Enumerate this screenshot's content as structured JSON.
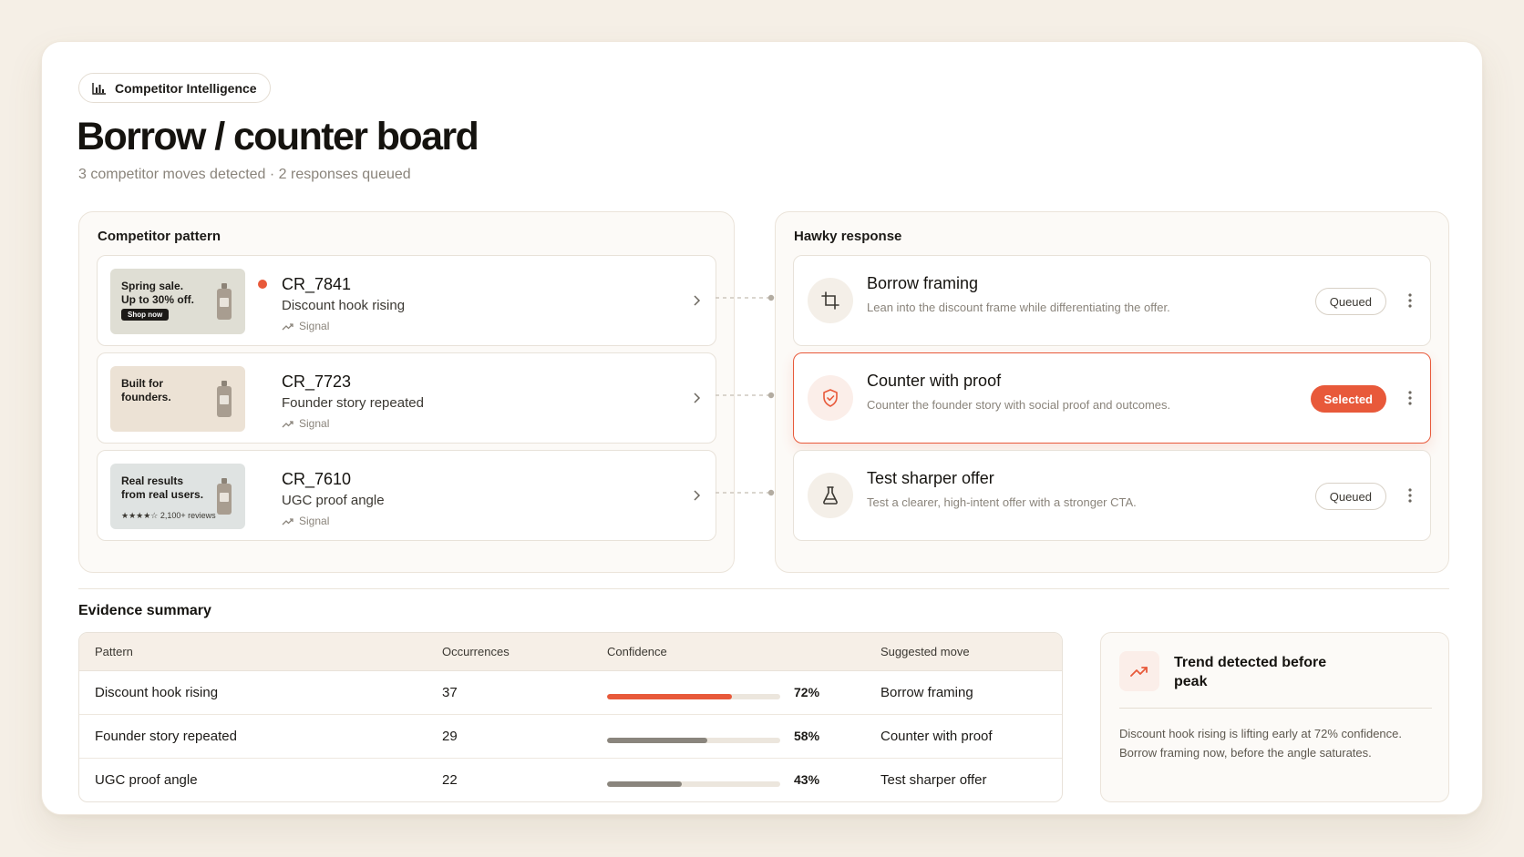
{
  "header": {
    "chip_label": "Competitor Intelligence",
    "title": "Borrow / counter board",
    "subtitle": "3 competitor moves detected · 2 responses queued"
  },
  "competitor_pattern": {
    "title": "Competitor pattern",
    "items": [
      {
        "id": "CR_7841",
        "desc": "Discount hook rising",
        "signal": "Signal",
        "thumb_text": "Spring sale.\nUp to 30% off.",
        "thumb_cta": "Shop now",
        "thumb_bg": "#dfded4",
        "has_dot": true
      },
      {
        "id": "CR_7723",
        "desc": "Founder story repeated",
        "signal": "Signal",
        "thumb_text": "Built for\nfounders.",
        "thumb_bg": "#ece2d5",
        "has_dot": false
      },
      {
        "id": "CR_7610",
        "desc": "UGC proof angle",
        "signal": "Signal",
        "thumb_text": "Real results\nfrom real users.",
        "thumb_stars": "★★★★☆  2,100+ reviews",
        "thumb_bg": "#dfe3e2",
        "has_dot": false
      }
    ]
  },
  "hawky_response": {
    "title": "Hawky response",
    "items": [
      {
        "title": "Borrow framing",
        "desc": "Lean into the discount frame while differentiating the offer.",
        "status": "Queued",
        "icon": "crop-icon"
      },
      {
        "title": "Counter with proof",
        "desc": "Counter the founder story with social proof and outcomes.",
        "status": "Selected",
        "icon": "shield-check-icon"
      },
      {
        "title": "Test sharper offer",
        "desc": "Test a clearer, high-intent offer with a stronger CTA.",
        "status": "Queued",
        "icon": "flask-icon"
      }
    ]
  },
  "evidence": {
    "title": "Evidence summary",
    "columns": [
      "Pattern",
      "Occurrences",
      "Confidence",
      "Suggested move"
    ],
    "rows": [
      {
        "pattern": "Discount hook rising",
        "occurrences": "37",
        "confidence": 0.72,
        "confidence_label": "72%",
        "move": "Borrow framing",
        "bar_color": "#e8593a"
      },
      {
        "pattern": "Founder story repeated",
        "occurrences": "29",
        "confidence": 0.58,
        "confidence_label": "58%",
        "move": "Counter with proof",
        "bar_color": "#8a857d"
      },
      {
        "pattern": "UGC proof angle",
        "occurrences": "22",
        "confidence": 0.43,
        "confidence_label": "43%",
        "move": "Test sharper offer",
        "bar_color": "#8a857d"
      }
    ]
  },
  "trend": {
    "title": "Trend detected before peak",
    "body": "Discount hook rising is lifting early at 72% confidence. Borrow framing now, before the angle saturates."
  },
  "colors": {
    "accent": "#e8593a",
    "bg": "#f5efe6"
  }
}
